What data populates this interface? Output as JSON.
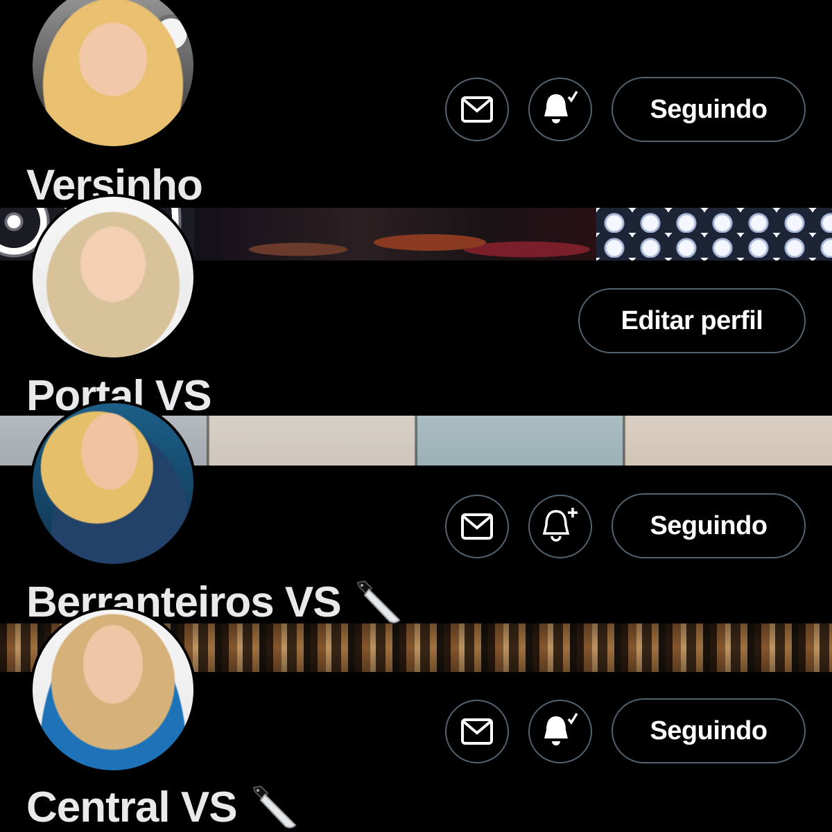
{
  "profiles": [
    {
      "name": "Versinho",
      "buttons": {
        "message_icon": "mail-icon",
        "notify_icon": "bell-subscribed-icon",
        "action_label": "Seguindo"
      }
    },
    {
      "name": "Portal VS",
      "buttons": {
        "action_label": "Editar perfil"
      }
    },
    {
      "name": "Berranteiros VS",
      "name_emoji": "kitchen-knife-icon",
      "buttons": {
        "message_icon": "mail-icon",
        "notify_icon": "bell-plus-icon",
        "action_label": "Seguindo"
      }
    },
    {
      "name": "Central VS",
      "name_emoji": "kitchen-knife-icon",
      "buttons": {
        "message_icon": "mail-icon",
        "notify_icon": "bell-subscribed-icon",
        "action_label": "Seguindo"
      }
    }
  ],
  "colors": {
    "background": "#000000",
    "text": "#e7e9ea",
    "button_border": "#536471"
  }
}
